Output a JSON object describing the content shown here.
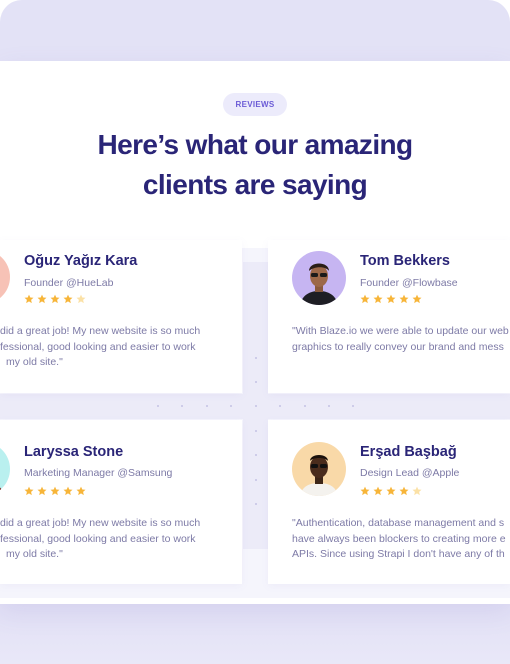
{
  "section": {
    "badge": "REVIEWS",
    "title_line1": "Here’s what our amazing",
    "title_line2": "clients are saying"
  },
  "reviews": [
    {
      "name": "Oğuz Yağız Kara",
      "role": "Founder @HueLab",
      "rating": 4.5,
      "quote": [
        "did a great job! My new website is so much",
        "fessional, good looking and easier to work",
        "my old site.\""
      ]
    },
    {
      "name": "Tom Bekkers",
      "role": "Founder @Flowbase",
      "rating": 5,
      "quote": [
        "\"With Blaze.io we were able to update our web",
        "graphics to really convey our brand and mess"
      ]
    },
    {
      "name": "Laryssa Stone",
      "role": "Marketing Manager @Samsung",
      "rating": 5,
      "quote": [
        "did a great job! My new website is so much",
        "fessional, good looking and easier to work",
        "my old site.\""
      ]
    },
    {
      "name": "Erşad Başbağ",
      "role": "Design Lead @Apple",
      "rating": 4.5,
      "quote": [
        "\"Authentication, database management and s",
        "have always been blockers to creating more e",
        "APIs. Since using Strapi I don't have any of th"
      ]
    }
  ],
  "colors": {
    "accent": "#6b5bd6",
    "heading": "#2a2577",
    "star_fill": "#f7b539",
    "star_half": "#fbe1a6",
    "body_text": "#7d7aa6"
  }
}
